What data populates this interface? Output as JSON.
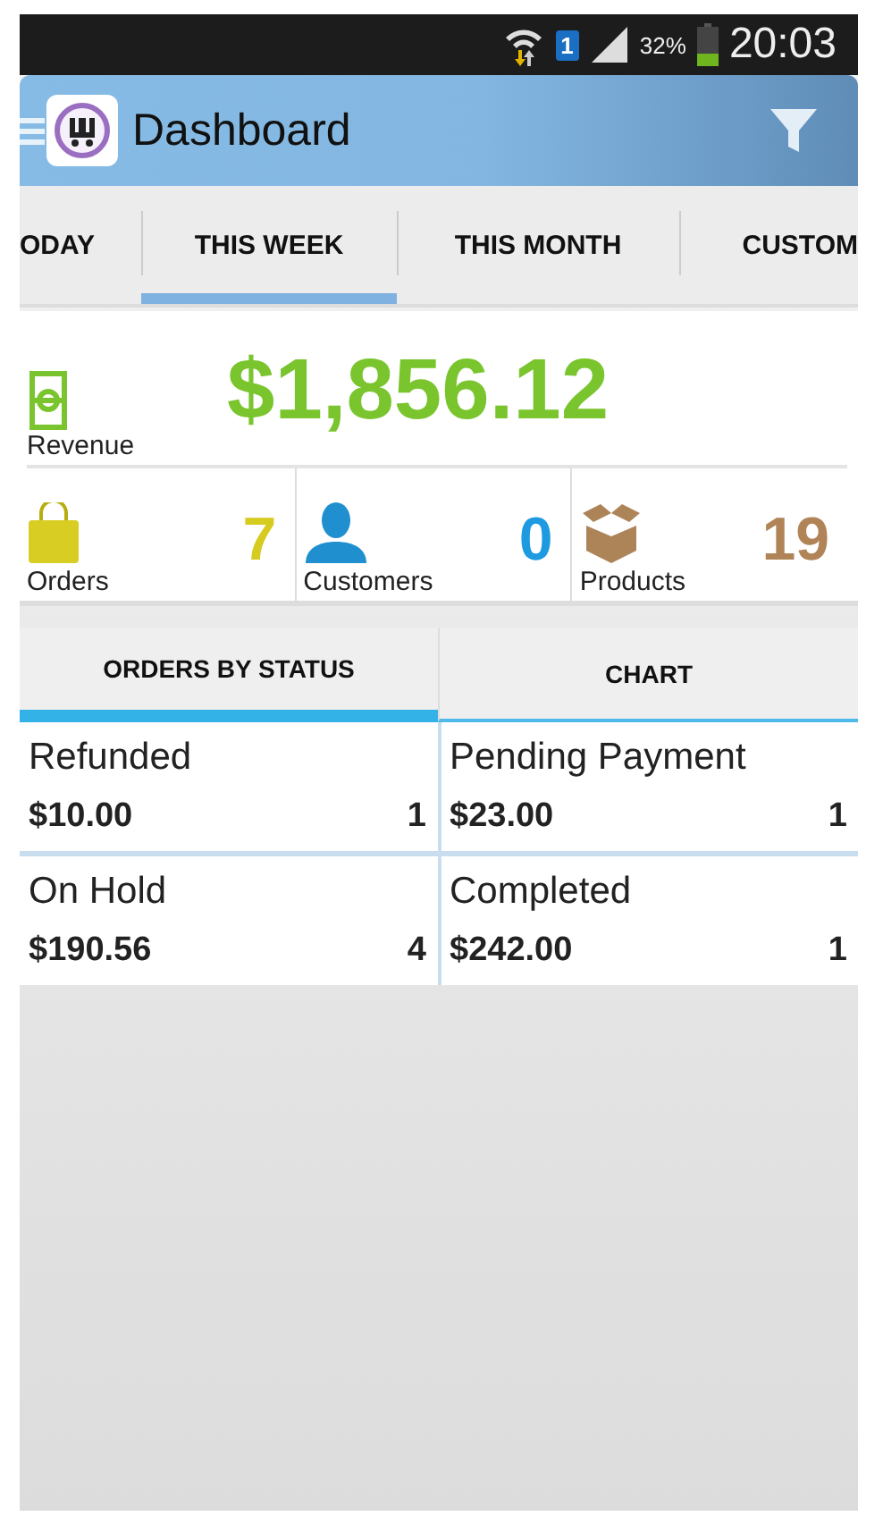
{
  "status_bar": {
    "battery": "32%",
    "time": "20:03",
    "sim": "1"
  },
  "app_bar": {
    "title": "Dashboard"
  },
  "tabs": [
    {
      "label": "ODAY",
      "selected": false
    },
    {
      "label": "THIS WEEK",
      "selected": true
    },
    {
      "label": "THIS MONTH",
      "selected": false
    },
    {
      "label": "CUSTOM",
      "selected": false
    }
  ],
  "revenue": {
    "label": "Revenue",
    "value": "$1,856.12",
    "color": "#7ac52e"
  },
  "stats": [
    {
      "kind": "orders",
      "label": "Orders",
      "value": "7",
      "color": "#d6cb1f"
    },
    {
      "kind": "customers",
      "label": "Customers",
      "value": "0",
      "color": "#1e9ae0"
    },
    {
      "kind": "products",
      "label": "Products",
      "value": "19",
      "color": "#b08457"
    }
  ],
  "sub_tabs": [
    {
      "label": "ORDERS BY STATUS",
      "selected": true
    },
    {
      "label": "CHART",
      "selected": false
    }
  ],
  "status_cards": [
    {
      "name": "Refunded",
      "amount": "$10.00",
      "count": "1"
    },
    {
      "name": "Pending Payment",
      "amount": "$23.00",
      "count": "1"
    },
    {
      "name": "On Hold",
      "amount": "$190.56",
      "count": "4"
    },
    {
      "name": "Completed",
      "amount": "$242.00",
      "count": "1"
    }
  ]
}
